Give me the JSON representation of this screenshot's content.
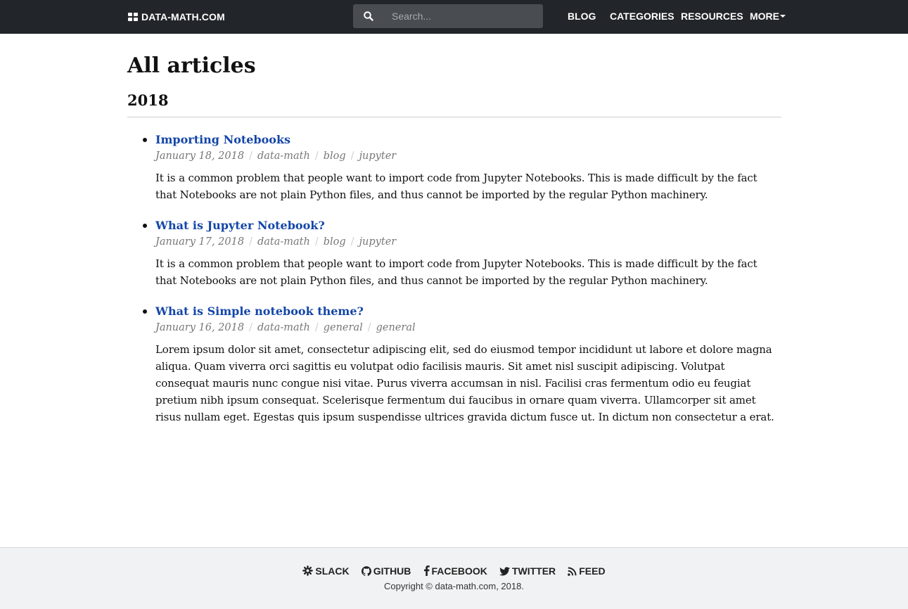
{
  "navbar": {
    "brand": "DATA-MATH.COM",
    "brand_icon": "grid-icon",
    "search_placeholder": "Search...",
    "links": [
      {
        "label": "BLOG"
      },
      {
        "label": "CATEGORIES"
      },
      {
        "label": "RESOURCES"
      },
      {
        "label": "MORE",
        "icon": "caret-down-icon"
      }
    ]
  },
  "main": {
    "title": "All articles",
    "year": "2018",
    "articles": [
      {
        "title": "Importing Notebooks",
        "date": "January 18, 2018",
        "author": "data-math",
        "category": "blog",
        "tag": "jupyter",
        "summary": "It is a common problem that people want to import code from Jupyter Notebooks. This is made difficult by the fact that Notebooks are not plain Python files, and thus cannot be imported by the regular Python machinery."
      },
      {
        "title": "What is Jupyter Notebook?",
        "date": "January 17, 2018",
        "author": "data-math",
        "category": "blog",
        "tag": "jupyter",
        "summary": "It is a common problem that people want to import code from Jupyter Notebooks. This is made difficult by the fact that Notebooks are not plain Python files, and thus cannot be imported by the regular Python machinery."
      },
      {
        "title": "What is Simple notebook theme?",
        "date": "January 16, 2018",
        "author": "data-math",
        "category": "general",
        "tag": "general",
        "summary": "Lorem ipsum dolor sit amet, consectetur adipiscing elit, sed do eiusmod tempor incididunt ut labore et dolore magna aliqua. Quam viverra orci sagittis eu volutpat odio facilisis mauris. Sit amet nisl suscipit adipiscing. Volutpat consequat mauris nunc congue nisi vitae. Purus viverra accumsan in nisl. Facilisi cras fermentum odio eu feugiat pretium nibh ipsum consequat. Scelerisque fermentum dui faucibus in ornare quam viverra. Ullamcorper sit amet risus nullam eget. Egestas quis ipsum suspendisse ultrices gravida dictum fusce ut. In dictum non consectetur a erat."
      }
    ]
  },
  "footer": {
    "links": [
      {
        "label": "SLACK",
        "icon": "slack-icon"
      },
      {
        "label": "GITHUB",
        "icon": "github-icon"
      },
      {
        "label": "FACEBOOK",
        "icon": "facebook-icon"
      },
      {
        "label": "TWITTER",
        "icon": "twitter-icon"
      },
      {
        "label": "FEED",
        "icon": "rss-feed-icon"
      }
    ],
    "copyright": "Copyright © data-math.com, 2018."
  },
  "colors": {
    "navbar_bg": "#222529",
    "search_bg": "#494c51",
    "link": "#1446a8",
    "meta": "#777777",
    "footer_bg": "#f1f2f3"
  }
}
